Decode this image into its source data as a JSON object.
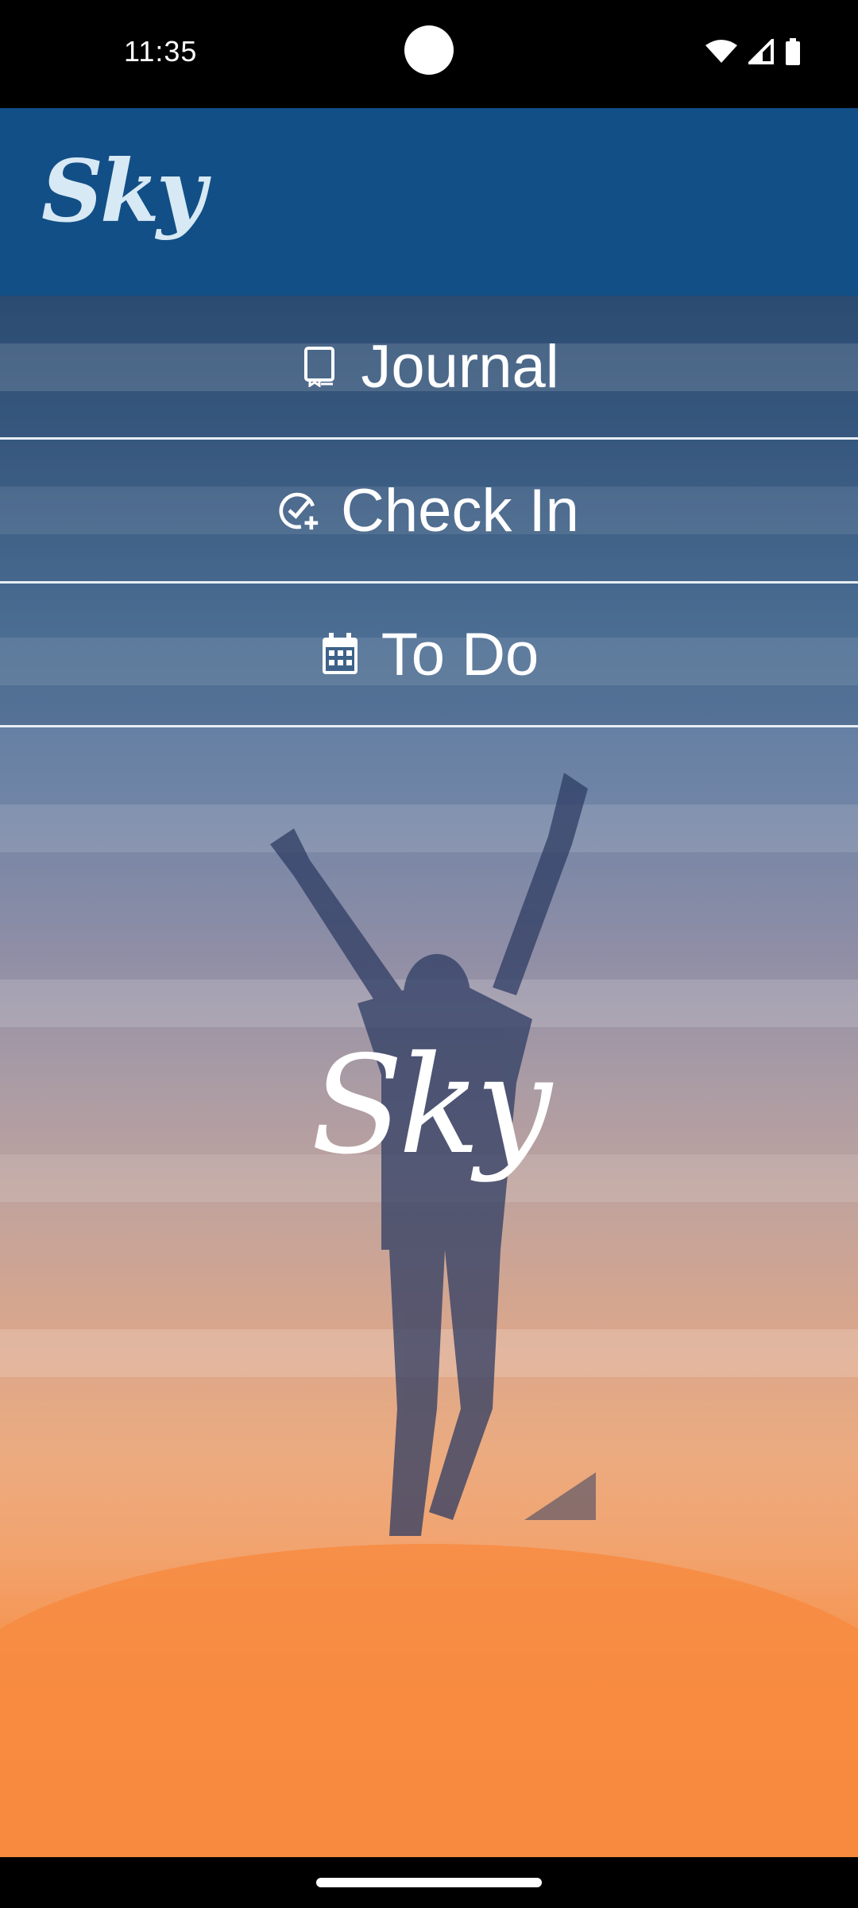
{
  "status_bar": {
    "time": "11:35",
    "icons": [
      "wifi-icon",
      "signal-icon",
      "battery-icon"
    ]
  },
  "app_bar": {
    "title": "Sky"
  },
  "menu": {
    "items": [
      {
        "label": "Journal",
        "icon": "journal-icon"
      },
      {
        "label": "Check In",
        "icon": "check-in-icon"
      },
      {
        "label": "To Do",
        "icon": "calendar-icon"
      }
    ]
  },
  "hero": {
    "logo_text": "Sky"
  },
  "colors": {
    "app_bar": "#124f86",
    "logo": "#d7e9f4",
    "menu_text": "#ffffff",
    "sky_top": "#2d4d72",
    "sky_bottom": "#fa8c42"
  }
}
